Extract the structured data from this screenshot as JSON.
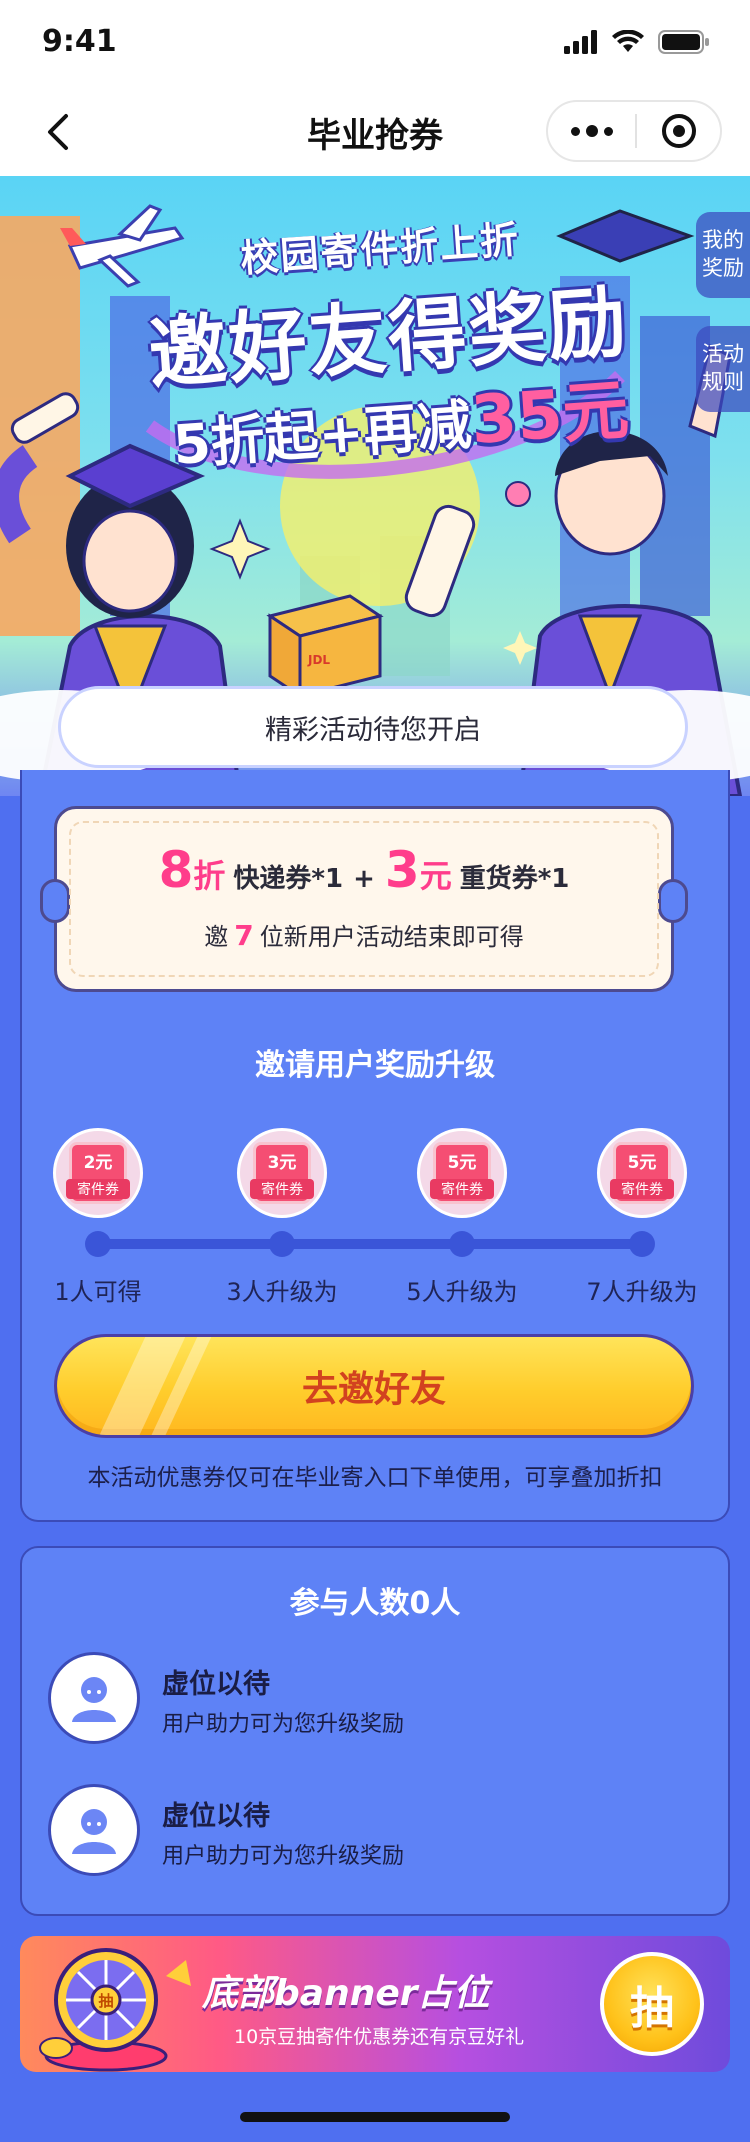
{
  "status_bar": {
    "time": "9:41"
  },
  "nav": {
    "title": "毕业抢券"
  },
  "hero": {
    "subtitle": "校园寄件折上折",
    "title": "邀好友得奖励",
    "offer_prefix": "5折起+再减",
    "offer_amount": "35元",
    "side_rewards": [
      "我的",
      "奖励"
    ],
    "side_rules": [
      "活动",
      "规则"
    ],
    "box_brand": "JDL 京东快递",
    "cloud_text": "精彩活动待您开启"
  },
  "coupon": {
    "discount_num": "8",
    "discount_unit": "折",
    "discount_name": "快递券*1",
    "plus": "+",
    "cash_num": "3",
    "cash_unit": "元",
    "cash_name": "重货券*1",
    "invite_prefix": "邀",
    "invite_count": "7",
    "invite_suffix": "位新用户活动结束即可得"
  },
  "upgrade": {
    "title": "邀请用户奖励升级",
    "tiers": [
      {
        "amount": "2元",
        "label": "寄件券",
        "text": "1人可得"
      },
      {
        "amount": "3元",
        "label": "寄件券",
        "text": "3人升级为"
      },
      {
        "amount": "5元",
        "label": "寄件券",
        "text": "5人升级为"
      },
      {
        "amount": "5元",
        "label": "寄件券",
        "text": "7人升级为"
      }
    ],
    "progress_invited": 0,
    "invite_button": "去邀好友",
    "notice": "本活动优惠券仅可在毕业寄入口下单使用，可享叠加折扣"
  },
  "participants": {
    "title": "参与人数0人",
    "rows": [
      {
        "name": "虚位以待",
        "desc": "用户助力可为您升级奖励"
      },
      {
        "name": "虚位以待",
        "desc": "用户助力可为您升级奖励"
      }
    ]
  },
  "banner": {
    "title": "底部banner占位",
    "subtitle": "10京豆抽寄件优惠券还有京豆好礼",
    "draw_label": "抽",
    "wheel_label": "抽"
  },
  "colors": {
    "page_bg": "#4f6ff0",
    "card_bg": "#5e82f6",
    "accent_pink": "#ff3d8b",
    "button_yellow": "#ffcd2c",
    "button_text": "#d2421f"
  }
}
